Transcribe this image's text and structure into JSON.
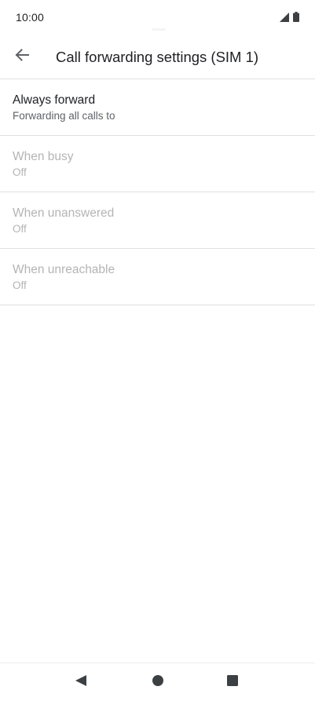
{
  "status_bar": {
    "time": "10:00",
    "icons": [
      "signal-icon",
      "battery-icon"
    ]
  },
  "header": {
    "back_icon": "arrow-left-icon",
    "title": "Call forwarding settings (SIM 1)"
  },
  "settings": [
    {
      "title": "Always forward",
      "summary": "Forwarding all calls to",
      "enabled": true
    },
    {
      "title": "When busy",
      "summary": "Off",
      "enabled": false
    },
    {
      "title": "When unanswered",
      "summary": "Off",
      "enabled": false
    },
    {
      "title": "When unreachable",
      "summary": "Off",
      "enabled": false
    }
  ],
  "nav_bar": {
    "icons": [
      "back-triangle-icon",
      "home-circle-icon",
      "recents-square-icon"
    ]
  },
  "colors": {
    "text_primary": "#202124",
    "text_secondary": "#5f6368",
    "text_disabled": "#b4b4b4",
    "divider": "#e0e0e0",
    "icon": "#5f6368"
  }
}
